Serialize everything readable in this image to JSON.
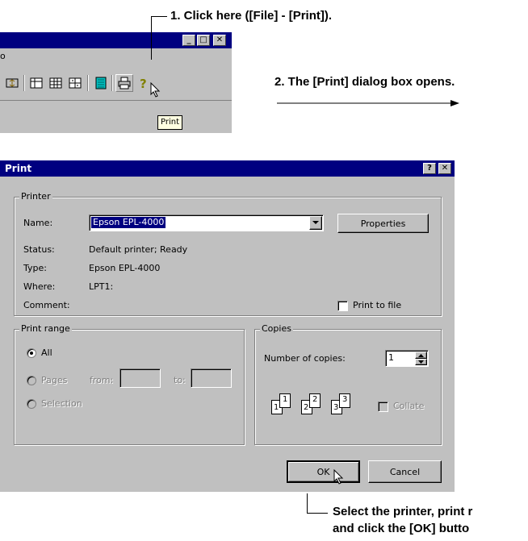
{
  "annotations": {
    "step1": "1. Click here ([File] - [Print]).",
    "step2": "2. The [Print] dialog box opens.",
    "step3_line1": "Select the printer, print r",
    "step3_line2": "and click the [OK] butto"
  },
  "top_window": {
    "menu_fragment": "o",
    "tooltip": "Print",
    "title_buttons": [
      "_",
      "□",
      "✕"
    ],
    "toolbar_icons": [
      "align-icon",
      "table-icon",
      "grid-icon",
      "cells-icon",
      "calculator-icon",
      "print-icon",
      "help-icon"
    ]
  },
  "dialog": {
    "title": "Print",
    "help_button": "?",
    "close_button": "✕",
    "printer_group": {
      "title": "Printer",
      "name_label": "Name:",
      "name_value": "Epson EPL-4000",
      "properties_button": "Properties",
      "status_label": "Status:",
      "status_value": "Default printer; Ready",
      "type_label": "Type:",
      "type_value": "Epson EPL-4000",
      "where_label": "Where:",
      "where_value": "LPT1:",
      "comment_label": "Comment:",
      "print_to_file": "Print to file"
    },
    "range_group": {
      "title": "Print range",
      "all": "All",
      "pages": "Pages",
      "from": "from:",
      "to": "to:",
      "selection": "Selection"
    },
    "copies_group": {
      "title": "Copies",
      "number_label": "Number of copies:",
      "number_value": "1",
      "collate": "Collate",
      "collate_icons": [
        "1",
        "1",
        "2",
        "2",
        "3",
        "3"
      ]
    },
    "ok_button": "OK",
    "cancel_button": "Cancel"
  }
}
